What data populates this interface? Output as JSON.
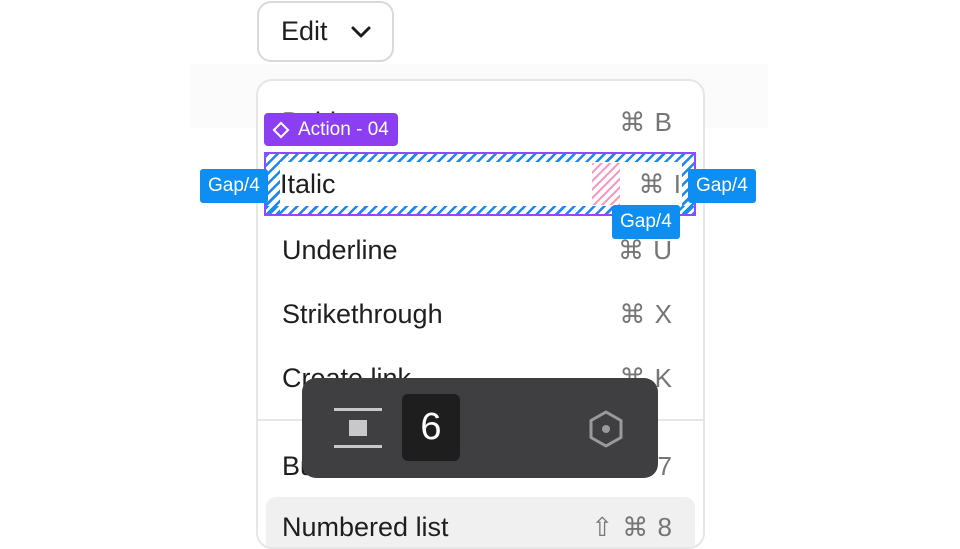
{
  "dropdown": {
    "label": "Edit",
    "icon": "chevron-down-icon"
  },
  "menu": {
    "items": [
      {
        "label": "Bold",
        "shortcut": "⌘ B"
      },
      {
        "label": "Italic",
        "shortcut": "⌘ I"
      },
      {
        "label": "Underline",
        "shortcut": "⌘ U"
      },
      {
        "label": "Strikethrough",
        "shortcut": "⌘ X"
      },
      {
        "label": "Create link",
        "shortcut": "⌘ K"
      },
      {
        "label": "Bulleted list",
        "shortcut": "⌘ 7"
      },
      {
        "label": "Numbered list",
        "shortcut": "⇧ ⌘ 8"
      }
    ]
  },
  "annotations": {
    "component_tag": "Action - 04",
    "component_icon": "component-diamond-icon",
    "gap_left": "Gap/4",
    "gap_right": "Gap/4",
    "gap_bottom": "Gap/4",
    "selection_color": "#9747ff",
    "gap_color": "#0d8ef0"
  },
  "spacing_toolbar": {
    "icon": "vertical-spacing-icon",
    "value": "6",
    "variable_icon": "variable-hexagon-icon"
  }
}
